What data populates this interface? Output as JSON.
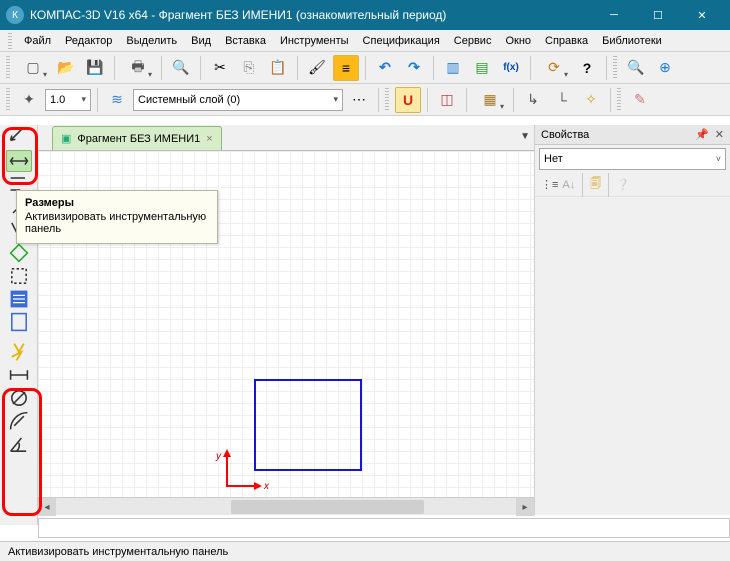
{
  "title": "КОМПАС-3D V16  x64 - Фрагмент БЕЗ ИМЕНИ1 (ознакомительный период)",
  "menu": [
    "Файл",
    "Редактор",
    "Выделить",
    "Вид",
    "Вставка",
    "Инструменты",
    "Спецификация",
    "Сервис",
    "Окно",
    "Справка",
    "Библиотеки"
  ],
  "toolbar2": {
    "line_width": "1.0",
    "layer": "Системный слой (0)"
  },
  "doc_tab": {
    "label": "Фрагмент БЕЗ ИМЕНИ1"
  },
  "tooltip": {
    "title": "Размеры",
    "body": "Активизировать инструментальную панель"
  },
  "canvas": {
    "origin_x_label": "x",
    "origin_y_label": "y"
  },
  "properties": {
    "title": "Свойства",
    "dropdown_value": "Нет"
  },
  "status": "Активизировать инструментальную панель"
}
